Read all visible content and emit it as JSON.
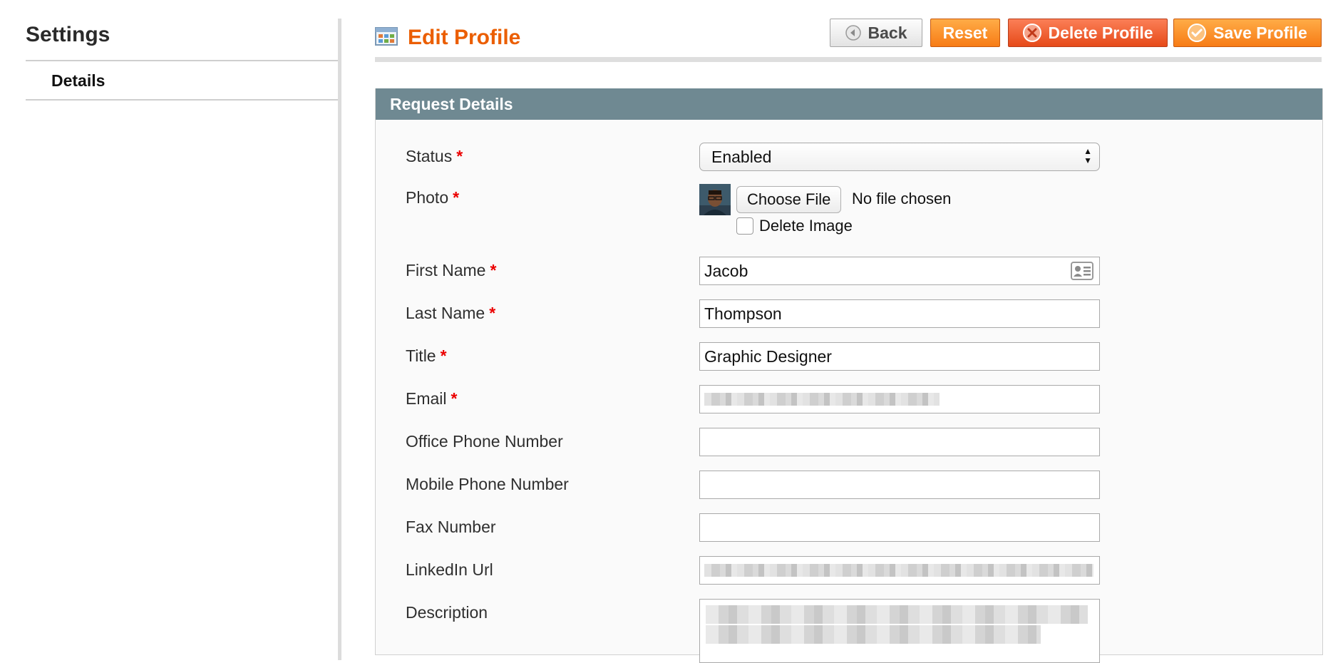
{
  "sidebar": {
    "title": "Settings",
    "items": [
      {
        "label": "Details"
      }
    ]
  },
  "header": {
    "title": "Edit Profile",
    "buttons": {
      "back": "Back",
      "reset": "Reset",
      "delete": "Delete Profile",
      "save": "Save Profile"
    }
  },
  "section": {
    "title": "Request Details"
  },
  "form": {
    "status": {
      "label": "Status",
      "value": "Enabled",
      "required": "*"
    },
    "photo": {
      "label": "Photo",
      "required": "*",
      "choose_label": "Choose File",
      "no_file_text": "No file chosen",
      "delete_label": "Delete Image"
    },
    "first_name": {
      "label": "First Name",
      "value": "Jacob",
      "required": "*"
    },
    "last_name": {
      "label": "Last Name",
      "value": "Thompson",
      "required": "*"
    },
    "title": {
      "label": "Title",
      "value": "Graphic Designer",
      "required": "*"
    },
    "email": {
      "label": "Email",
      "required": "*"
    },
    "office_phone": {
      "label": "Office Phone Number",
      "value": ""
    },
    "mobile_phone": {
      "label": "Mobile Phone Number",
      "value": ""
    },
    "fax": {
      "label": "Fax Number",
      "value": ""
    },
    "linkedin": {
      "label": "LinkedIn Url"
    },
    "description": {
      "label": "Description"
    }
  },
  "colors": {
    "accent": "#eb5e00",
    "section_header": "#6f8992",
    "required": "#eb0000"
  },
  "icons": {
    "title": "grid-table-icon",
    "back": "arrow-left-circle-icon",
    "delete": "x-circle-icon",
    "save": "check-circle-icon",
    "first_name_field": "contact-card-icon"
  }
}
